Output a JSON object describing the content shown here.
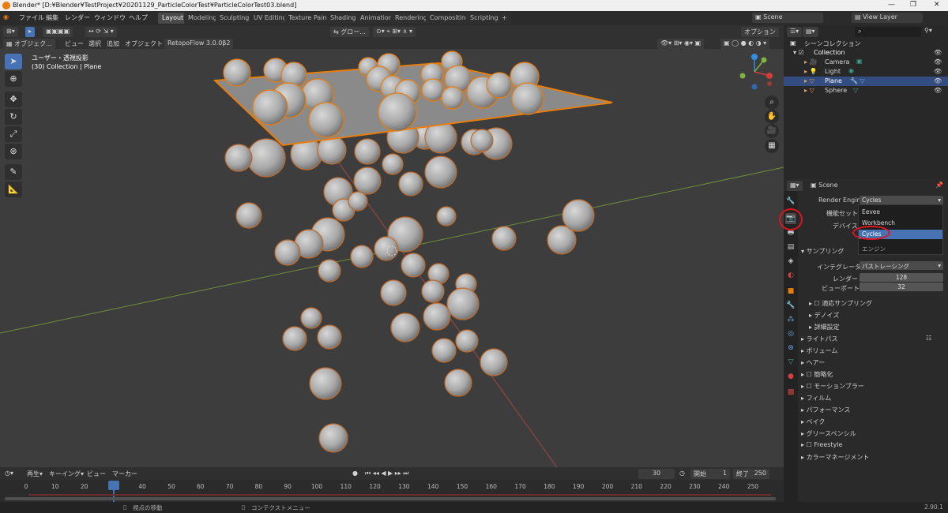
{
  "window": {
    "title": "Blender* [D:¥Blender¥TestProject¥20201129_ParticleColorTest¥ParticleColorTest03.blend]"
  },
  "menu": [
    "ファイル",
    "編集",
    "レンダー",
    "ウィンドウ",
    "ヘルプ"
  ],
  "workspaces": [
    "Layout",
    "Modeling",
    "Sculpting",
    "UV Editing",
    "Texture Paint",
    "Shading",
    "Animation",
    "Rendering",
    "Compositing",
    "Scripting",
    "+"
  ],
  "scene": {
    "name": "Scene",
    "view_layer": "View Layer"
  },
  "viewport": {
    "header": {
      "mode": "オブジェク...",
      "view": "ビュー",
      "select": "選択",
      "add": "追加",
      "object": "オブジェクト",
      "addon": "RetopoFlow 3.0.0β2",
      "transform": "グロー...",
      "options": "オプション"
    },
    "info_line1": "ユーザー・透視投影",
    "info_line2": "(30) Collection | Plane"
  },
  "outliner": {
    "scene_collection": "シーンコレクション",
    "items": [
      {
        "label": "Collection",
        "icon": "collection-icon"
      },
      {
        "label": "Camera",
        "icon": "camera-icon"
      },
      {
        "label": "Light",
        "icon": "light-icon"
      },
      {
        "label": "Plane",
        "icon": "mesh-icon",
        "selected": true
      },
      {
        "label": "Sphere",
        "icon": "mesh-icon"
      }
    ]
  },
  "properties": {
    "context": "Scene",
    "render_engine_label": "Render Engine",
    "render_engine_value": "Cycles",
    "feature_set_label": "機能セット",
    "device_label": "デバイス",
    "dropdown": {
      "items": [
        "Eevee",
        "Workbench",
        "Cycles"
      ],
      "selected": "Cycles",
      "footer": "エンジン"
    },
    "sampling": {
      "title": "サンプリング",
      "integrator_label": "インテグレータ",
      "integrator_value": "パストレーシング",
      "render_label": "レンダー",
      "render_value": "128",
      "viewport_label": "ビューポート",
      "viewport_value": "32"
    },
    "sub_sections": [
      "適応サンプリング",
      "デノイズ",
      "詳細設定"
    ],
    "sections": [
      "ライトパス",
      "ボリューム",
      "ヘアー",
      "簡略化",
      "モーションブラー",
      "フィルム",
      "パフォーマンス",
      "ベイク",
      "グリースペンシル",
      "Freestyle",
      "カラーマネージメント"
    ]
  },
  "timeline": {
    "playback": "再生",
    "keying": "キーイング",
    "view": "ビュー",
    "marker": "マーカー",
    "current_frame": "30",
    "start_label": "開始",
    "start": "1",
    "end_label": "終了",
    "end": "250",
    "ticks": [
      "0",
      "10",
      "20",
      "30",
      "40",
      "50",
      "60",
      "70",
      "80",
      "90",
      "100",
      "110",
      "120",
      "130",
      "140",
      "150",
      "160",
      "170",
      "180",
      "190",
      "200",
      "210",
      "220",
      "230",
      "240",
      "250"
    ]
  },
  "statusbar": {
    "left": "視点の移動",
    "middle": "コンテクストメニュー",
    "version": "2.90.1"
  },
  "colors": {
    "accent": "#4772b3",
    "selection_outline": "#e87d0d",
    "highlight_circle": "#e0141c",
    "viewport_bg": "#3d3d3d"
  }
}
